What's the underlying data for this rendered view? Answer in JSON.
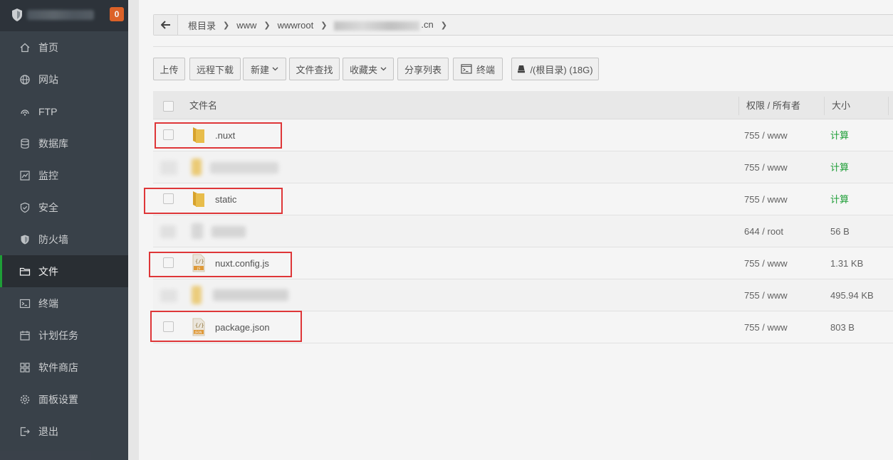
{
  "sidebar": {
    "notification_count": "0",
    "items": [
      {
        "label": "首页",
        "icon": "home-icon"
      },
      {
        "label": "网站",
        "icon": "globe-icon"
      },
      {
        "label": "FTP",
        "icon": "ftp-icon"
      },
      {
        "label": "数据库",
        "icon": "database-icon"
      },
      {
        "label": "监控",
        "icon": "monitor-icon"
      },
      {
        "label": "安全",
        "icon": "shield-icon"
      },
      {
        "label": "防火墙",
        "icon": "firewall-icon"
      },
      {
        "label": "文件",
        "icon": "folder-icon",
        "active": true
      },
      {
        "label": "终端",
        "icon": "terminal-icon"
      },
      {
        "label": "计划任务",
        "icon": "calendar-icon"
      },
      {
        "label": "软件商店",
        "icon": "apps-icon"
      },
      {
        "label": "面板设置",
        "icon": "gear-icon"
      },
      {
        "label": "退出",
        "icon": "logout-icon"
      }
    ]
  },
  "breadcrumb": {
    "items": [
      "根目录",
      "www",
      "wwwroot"
    ],
    "last_suffix": ".cn"
  },
  "toolbar": {
    "upload": "上传",
    "remote_download": "远程下载",
    "new": "新建",
    "file_search": "文件查找",
    "favorites": "收藏夹",
    "share_list": "分享列表",
    "terminal": "终端",
    "disk": "/(根目录) (18G)"
  },
  "table": {
    "headers": {
      "name": "文件名",
      "perm": "权限 / 所有者",
      "size": "大小"
    },
    "rows": [
      {
        "name": ".nuxt",
        "type": "folder",
        "perm": "755 / www",
        "size": "计算",
        "calc": true,
        "highlighted": true,
        "blurred": false
      },
      {
        "name": "",
        "type": "folder",
        "perm": "755 / www",
        "size": "计算",
        "calc": true,
        "highlighted": false,
        "blurred": true
      },
      {
        "name": "static",
        "type": "folder",
        "perm": "755 / www",
        "size": "计算",
        "calc": true,
        "highlighted": true,
        "blurred": false
      },
      {
        "name": "",
        "type": "file",
        "perm": "644 / root",
        "size": "56 B",
        "calc": false,
        "highlighted": false,
        "blurred": true
      },
      {
        "name": "nuxt.config.js",
        "type": "js",
        "perm": "755 / www",
        "size": "1.31 KB",
        "calc": false,
        "highlighted": true,
        "blurred": false
      },
      {
        "name": "",
        "type": "folder",
        "perm": "755 / www",
        "size": "495.94 KB",
        "calc": false,
        "highlighted": false,
        "blurred": true
      },
      {
        "name": "package.json",
        "type": "json",
        "perm": "755 / www",
        "size": "803 B",
        "calc": false,
        "highlighted": true,
        "blurred": false
      }
    ]
  },
  "colors": {
    "sidebar_bg": "#3c444d",
    "accent_green": "#20a53a",
    "badge_orange": "#e5662a",
    "highlight_red": "#e8393b",
    "folder_yellow": "#f0c04a"
  }
}
